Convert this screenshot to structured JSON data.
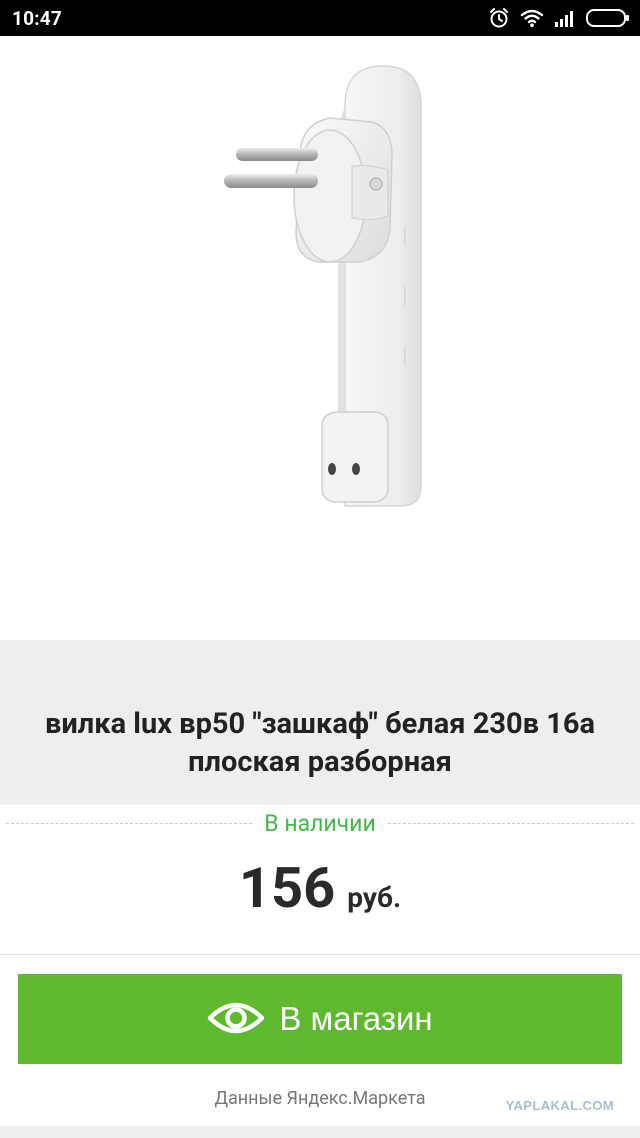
{
  "status_bar": {
    "time": "10:47",
    "icons": [
      "alarm-icon",
      "wifi-icon",
      "signal-icon",
      "battery-icon"
    ]
  },
  "product": {
    "image": "wall-plug-photo",
    "title": "вилка lux вр50 \"зашкаф\" белая 230в 16а плоская разборная",
    "availability": "В наличии",
    "price_value": "156",
    "price_currency": "руб."
  },
  "button": {
    "label": "В магазин",
    "icon": "eye-icon"
  },
  "footer": {
    "source": "Данные Яндекс.Маркета",
    "watermark": "YAPLAKAL.COM"
  },
  "colors": {
    "accent_green": "#5eb92e",
    "availability_green": "#45b84a",
    "title_bg": "#eeeeee"
  }
}
